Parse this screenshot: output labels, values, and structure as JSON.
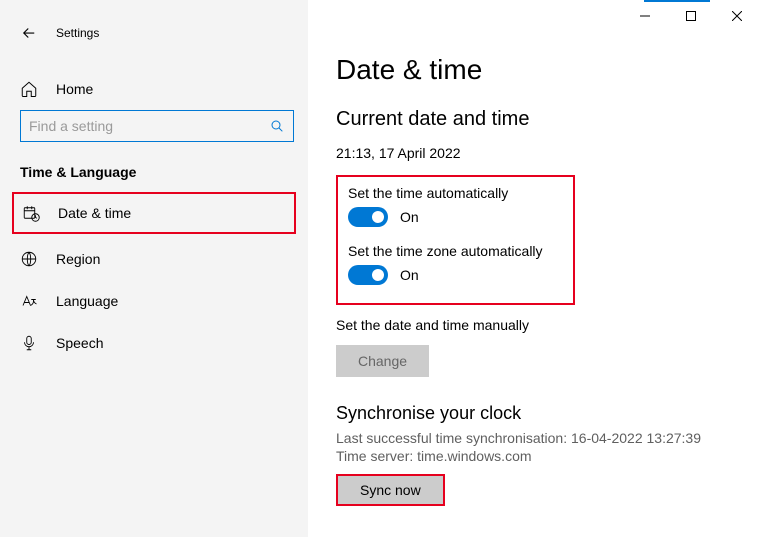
{
  "app": {
    "title": "Settings"
  },
  "sidebar": {
    "home": "Home",
    "search_placeholder": "Find a setting",
    "section": "Time & Language",
    "items": [
      {
        "label": "Date & time"
      },
      {
        "label": "Region"
      },
      {
        "label": "Language"
      },
      {
        "label": "Speech"
      }
    ]
  },
  "main": {
    "title": "Date & time",
    "current_heading": "Current date and time",
    "current_value": "21:13, 17 April 2022",
    "set_time_auto_label": "Set the time automatically",
    "set_time_auto_state": "On",
    "set_zone_auto_label": "Set the time zone automatically",
    "set_zone_auto_state": "On",
    "manual_label": "Set the date and time manually",
    "change_btn": "Change",
    "sync_heading": "Synchronise your clock",
    "sync_last": "Last successful time synchronisation: 16-04-2022 13:27:39",
    "sync_server": "Time server: time.windows.com",
    "sync_btn": "Sync now"
  }
}
